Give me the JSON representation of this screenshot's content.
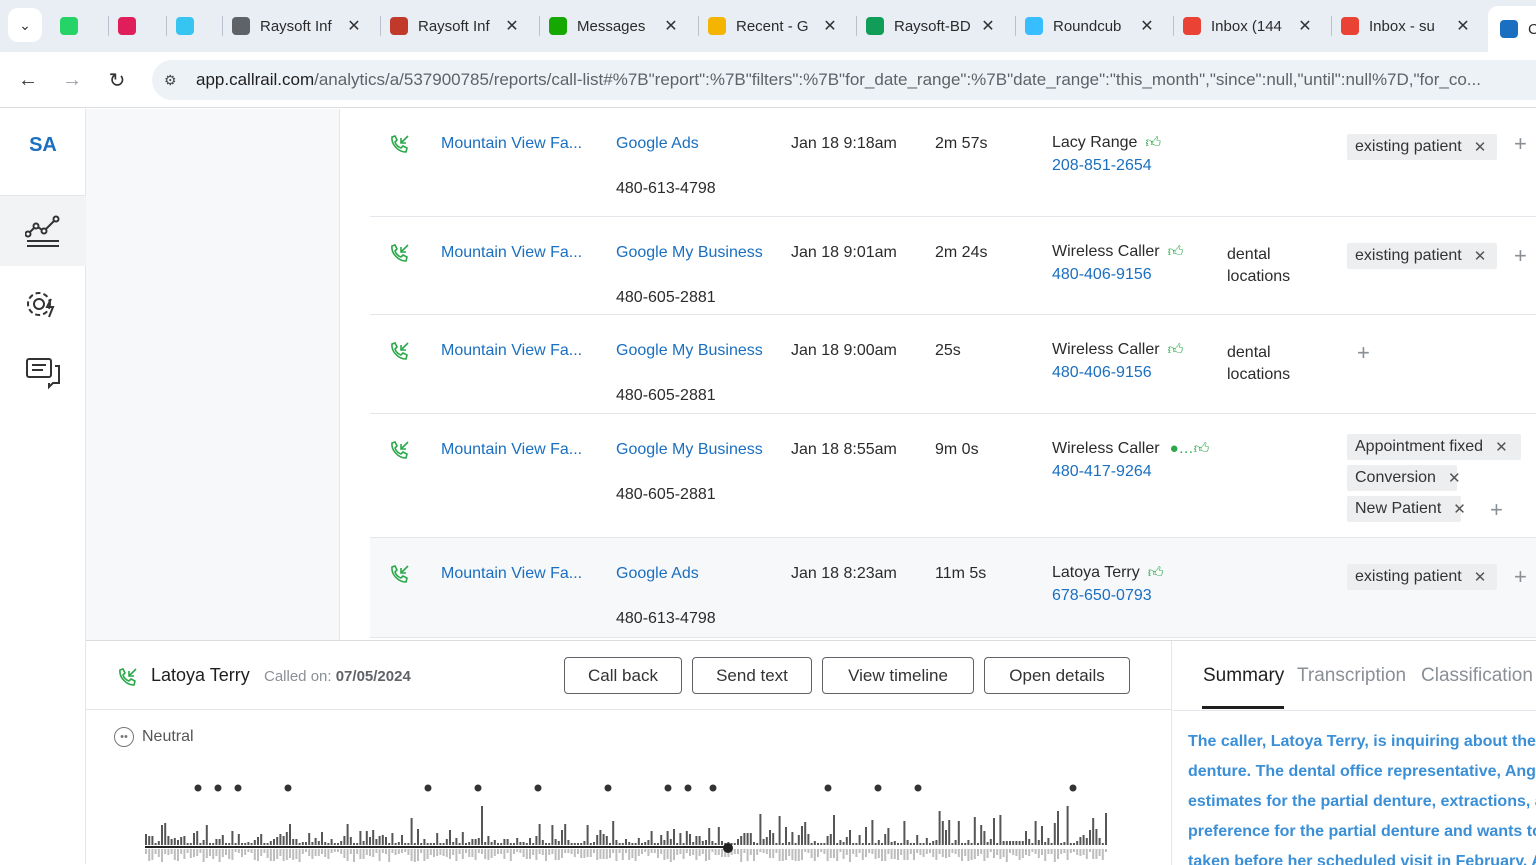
{
  "browser": {
    "tabs": [
      {
        "title": "",
        "icon": "whatsapp-icon",
        "color": "#25d366"
      },
      {
        "title": "",
        "icon": "slack-icon",
        "color": "#e01e5a"
      },
      {
        "title": "",
        "icon": "slack-icon",
        "color": "#36c5f0"
      },
      {
        "title": "Raysoft Inf",
        "icon": "globe-icon",
        "color": "#5f6368"
      },
      {
        "title": "Raysoft Inf",
        "icon": "raysoft-icon",
        "color": "#c0392b"
      },
      {
        "title": "Messages",
        "icon": "upwork-icon",
        "color": "#14a800"
      },
      {
        "title": "Recent - G",
        "icon": "drive-icon",
        "color": "#f4b400"
      },
      {
        "title": "Raysoft-BD",
        "icon": "sheets-icon",
        "color": "#0f9d58"
      },
      {
        "title": "Roundcub",
        "icon": "roundcube-icon",
        "color": "#37beff"
      },
      {
        "title": "Inbox (144",
        "icon": "gmail-icon",
        "color": "#ea4335"
      },
      {
        "title": "Inbox - su",
        "icon": "gmail-icon",
        "color": "#ea4335"
      },
      {
        "title": "C",
        "icon": "callrail-icon",
        "color": "#1a6fc0"
      }
    ],
    "url_host": "app.callrail.com",
    "url_path": "/analytics/a/537900785/reports/call-list#%7B\"report\":%7B\"filters\":%7B\"for_date_range\":%7B\"date_range\":\"this_month\",\"since\":null,\"until\":null%7D,\"for_co..."
  },
  "rail": {
    "initials": "SA"
  },
  "calls": [
    {
      "company": "Mountain View Fa...",
      "source": "Google Ads",
      "number": "480-613-4798",
      "date": "Jan 18 9:18am",
      "duration": "2m 57s",
      "caller": "Lacy Range",
      "phone": "208-851-2654",
      "keywords": "",
      "tags": [
        "existing patient"
      ]
    },
    {
      "company": "Mountain View Fa...",
      "source": "Google My Business",
      "number": "480-605-2881",
      "date": "Jan 18 9:01am",
      "duration": "2m 24s",
      "caller": "Wireless Caller",
      "phone": "480-406-9156",
      "keywords": "dental locations",
      "tags": [
        "existing patient"
      ]
    },
    {
      "company": "Mountain View Fa...",
      "source": "Google My Business",
      "number": "480-605-2881",
      "date": "Jan 18 9:00am",
      "duration": "25s",
      "caller": "Wireless Caller",
      "phone": "480-406-9156",
      "keywords": "dental locations",
      "tags": []
    },
    {
      "company": "Mountain View Fa...",
      "source": "Google My Business",
      "number": "480-605-2881",
      "date": "Jan 18 8:55am",
      "duration": "9m 0s",
      "caller": "Wireless Caller",
      "phone": "480-417-9264",
      "keywords": "",
      "tags": [
        "Appointment fixed",
        "Conversion",
        "New Patient"
      ]
    },
    {
      "company": "Mountain View Fa...",
      "source": "Google Ads",
      "number": "480-613-4798",
      "date": "Jan 18 8:23am",
      "duration": "11m 5s",
      "caller": "Latoya Terry",
      "phone": "678-650-0793",
      "keywords": "",
      "tags": [
        "existing patient"
      ]
    }
  ],
  "detail": {
    "caller": "Latoya Terry",
    "called_on_label": "Called on:",
    "called_on_date": "07/05/2024",
    "buttons": {
      "call_back": "Call back",
      "send_text": "Send text",
      "view_timeline": "View timeline",
      "open_details": "Open details"
    },
    "sentiment": "Neutral",
    "tabs": {
      "summary": "Summary",
      "transcription": "Transcription",
      "classification": "Classification"
    },
    "summary_lines": [
      "The caller, Latoya Terry, is inquiring about the c",
      "denture. The dental office representative, Ange",
      "estimates for the partial denture, extractions, a",
      "preference for the partial denture and wants to",
      "taken before her scheduled visit in February. A"
    ]
  }
}
